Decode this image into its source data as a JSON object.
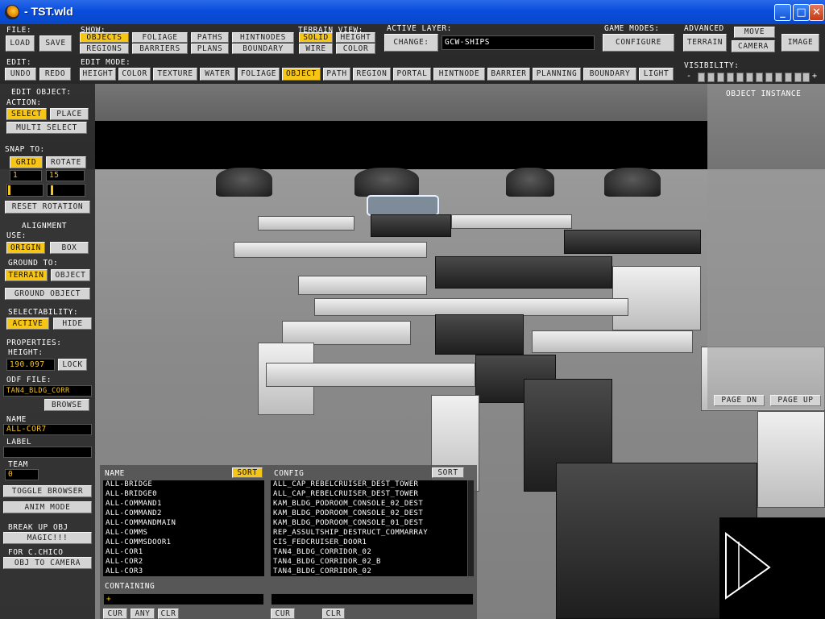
{
  "window": {
    "title": "- TST.wld",
    "min": "_",
    "max": "□",
    "close": "✕"
  },
  "file": {
    "label": "File:",
    "load": "Load",
    "save": "Save"
  },
  "show": {
    "label": "Show:",
    "items": [
      "Objects",
      "Foliage",
      "Paths",
      "HintNodes",
      "Regions",
      "Barriers",
      "Plans",
      "Boundary"
    ]
  },
  "terrain_view": {
    "label": "Terrain View:",
    "items": [
      "Solid",
      "Height",
      "Wire",
      "Color"
    ]
  },
  "active_layer": {
    "label": "Active Layer:",
    "change": "Change:",
    "value": "GCW-Ships"
  },
  "game_modes": {
    "label": "Game Modes:",
    "configure": "Configure"
  },
  "advanced": {
    "label": "Advanced",
    "terrain": "Terrain",
    "move": "Move",
    "camera": "Camera",
    "image": "Image"
  },
  "edit": {
    "label": "Edit:",
    "undo": "Undo",
    "redo": "Redo"
  },
  "edit_mode": {
    "label": "Edit Mode:",
    "items": [
      "Height",
      "Color",
      "Texture",
      "Water",
      "Foliage",
      "Object",
      "Path",
      "Region",
      "Portal",
      "HintNode",
      "Barrier",
      "Planning",
      "Boundary",
      "Light"
    ]
  },
  "visibility": {
    "label": "Visibility:",
    "minus": "-",
    "plus": "+"
  },
  "edit_object": {
    "title": "Edit Object:",
    "action_label": "Action:",
    "select": "Select",
    "place": "Place",
    "multi_select": "Multi Select",
    "snap_label": "Snap To:",
    "grid": "Grid",
    "rotate": "Rotate",
    "grid_value": "1",
    "rotate_value": "15",
    "reset_rotation": "Reset Rotation",
    "alignment": "Alignment",
    "use_label": "Use:",
    "origin": "Origin",
    "box": "Box",
    "ground_to": "Ground To:",
    "terrain": "Terrain",
    "object": "Object",
    "ground_object": "Ground Object",
    "selectability": "Selectability:",
    "active": "Active",
    "hide": "Hide",
    "properties": "Properties:",
    "height_label": "Height:",
    "height_value": "190.097",
    "lock": "Lock",
    "odf_label": "Odf File:",
    "odf_value": "tan4_bldg_corr",
    "browse": "Browse",
    "name_label": "Name",
    "name_value": "all-cor7",
    "label_label": "Label",
    "team_label": "Team",
    "team_value": "0",
    "toggle_browser": "Toggle Browser",
    "anim_mode": "Anim Mode",
    "break_up_label": "Break Up Obj",
    "magic": "Magic!!!",
    "for_label": "For C.Chico",
    "obj_to_camera": "Obj To Camera"
  },
  "right_panel": {
    "title": "Object Instance",
    "page_dn": "Page Dn",
    "page_up": "Page Up"
  },
  "browser": {
    "name_header": "Name",
    "sort": "Sort",
    "config_header": "Config",
    "names": [
      "all-bridge",
      "all-bridge0",
      "all-command1",
      "all-command2",
      "all-commandmain",
      "all-comms",
      "all-commsdoor1",
      "all-cor1",
      "all-cor2",
      "all-cor3"
    ],
    "configs": [
      "all_cap_rebelcruiser_dest_tower",
      "all_cap_rebelcruiser_dest_tower",
      "kam_bldg_podroom_console_02_dest",
      "kam_bldg_podroom_console_02_dest",
      "kam_bldg_podroom_console_01_dest",
      "rep_assultship_destruct_commarray",
      "cis_fedcruiser_door1",
      "tan4_bldg_corridor_02",
      "tan4_bldg_corridor_02_b",
      "tan4_bldg_corridor_02"
    ],
    "containing_label": "Containing",
    "containing_value": "+",
    "cur": "Cur",
    "any": "Any",
    "clr": "Clr"
  }
}
